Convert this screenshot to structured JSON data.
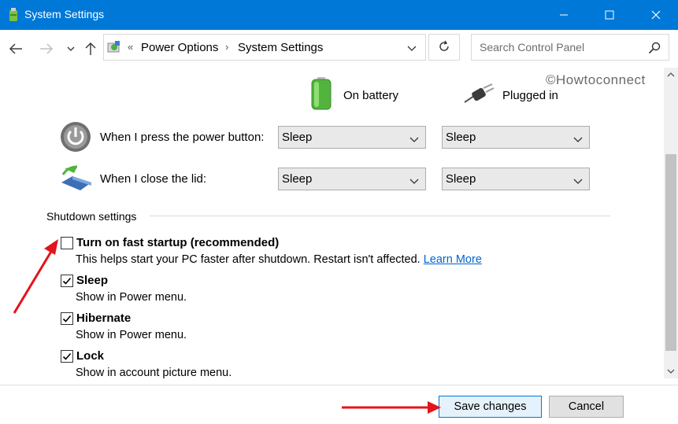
{
  "window": {
    "title": "System Settings",
    "minimize_icon": "minimize-icon",
    "maximize_icon": "maximize-icon",
    "close_icon": "close-icon"
  },
  "nav": {
    "breadcrumb_root": "Power Options",
    "breadcrumb_current": "System Settings",
    "search_placeholder": "Search Control Panel"
  },
  "watermark": "©Howtoconnect",
  "power_header": {
    "on_battery": "On battery",
    "plugged_in": "Plugged in"
  },
  "power_rows": [
    {
      "label": "When I press the power button:",
      "battery": "Sleep",
      "plugged": "Sleep"
    },
    {
      "label": "When I close the lid:",
      "battery": "Sleep",
      "plugged": "Sleep"
    }
  ],
  "shutdown": {
    "section_label": "Shutdown settings",
    "options": [
      {
        "title": "Turn on fast startup (recommended)",
        "desc": "This helps start your PC faster after shutdown. Restart isn't affected.",
        "link": "Learn More",
        "checked": false
      },
      {
        "title": "Sleep",
        "desc": "Show in Power menu.",
        "checked": true
      },
      {
        "title": "Hibernate",
        "desc": "Show in Power menu.",
        "checked": true
      },
      {
        "title": "Lock",
        "desc": "Show in account picture menu.",
        "checked": true
      }
    ]
  },
  "footer": {
    "save_label": "Save changes",
    "cancel_label": "Cancel"
  },
  "colors": {
    "titlebar": "#0078d7",
    "link": "#0066cc",
    "annotation_arrow": "#e3141b"
  }
}
